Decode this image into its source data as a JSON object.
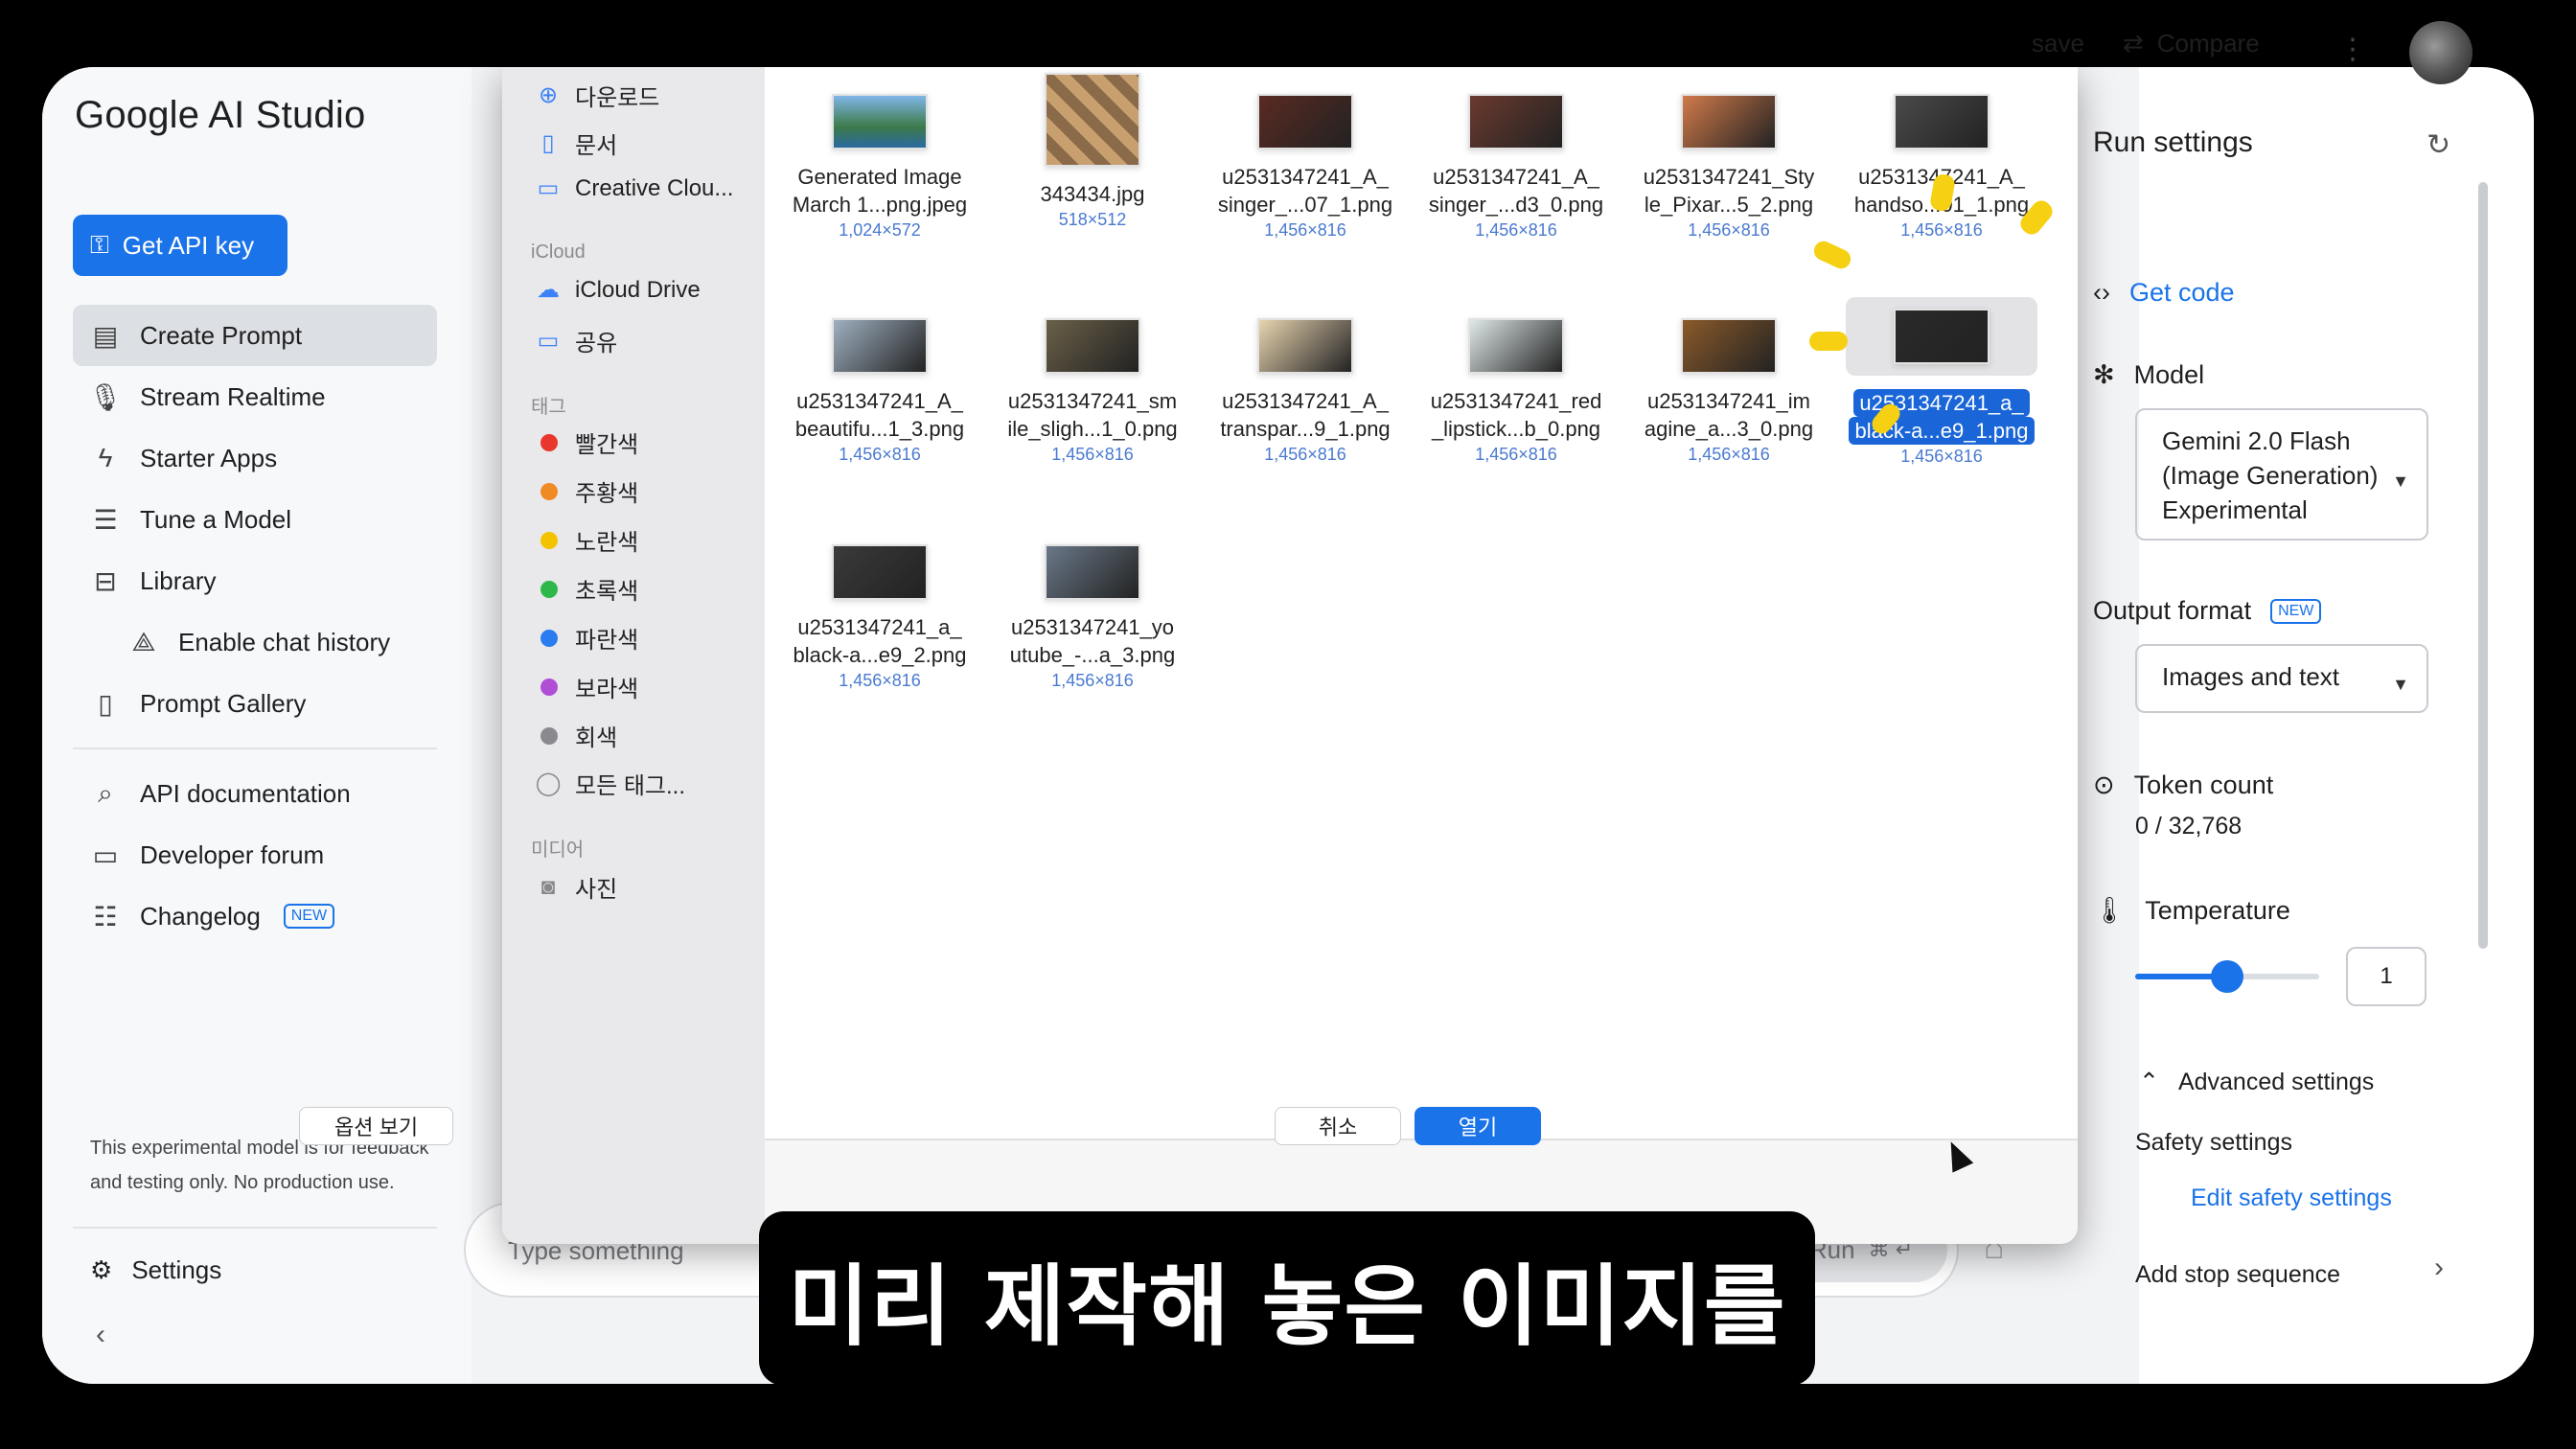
{
  "app": {
    "logo": "Google AI Studio",
    "api_key_label": "Get API key"
  },
  "nav": {
    "create_prompt": "Create Prompt",
    "stream_realtime": "Stream Realtime",
    "starter_apps": "Starter Apps",
    "tune_model": "Tune a Model",
    "library": "Library",
    "enable_chat_history": "Enable chat history",
    "prompt_gallery": "Prompt Gallery",
    "api_documentation": "API documentation",
    "developer_forum": "Developer forum",
    "changelog": "Changelog",
    "new_badge": "NEW"
  },
  "disclaimer": "This experimental model is for feedback and testing only. No production use.",
  "settings_label": "Settings",
  "prompt": {
    "placeholder": "Type something",
    "run_label": "Run",
    "run_shortcut": "⌘ ↵"
  },
  "header": {
    "save_label": "save",
    "compare_label": "Compare"
  },
  "run_settings": {
    "title": "Run settings",
    "get_code": "Get code",
    "model_label": "Model",
    "model_value": "Gemini 2.0 Flash (Image Generation) Experimental",
    "output_format_label": "Output format",
    "output_format_badge": "NEW",
    "output_format_value": "Images and text",
    "token_count_label": "Token count",
    "token_count_value": "0 / 32,768",
    "temperature_label": "Temperature",
    "temperature_value": "1",
    "temperature_fraction": 0.5,
    "advanced_label": "Advanced settings",
    "safety_label": "Safety settings",
    "edit_safety": "Edit safety settings",
    "stop_sequence": "Add stop sequence"
  },
  "dialog": {
    "favorites": [
      "다운로드",
      "문서",
      "Creative Clou..."
    ],
    "icloud_head": "iCloud",
    "icloud_items": [
      "iCloud Drive",
      "공유"
    ],
    "tags_head": "태그",
    "tags": [
      {
        "label": "빨간색",
        "color": "#e8372c"
      },
      {
        "label": "주황색",
        "color": "#f08a24"
      },
      {
        "label": "노란색",
        "color": "#f4c300"
      },
      {
        "label": "초록색",
        "color": "#2fb84a"
      },
      {
        "label": "파란색",
        "color": "#2a7cf0"
      },
      {
        "label": "보라색",
        "color": "#b04fd6"
      },
      {
        "label": "회색",
        "color": "#8a8a8e"
      }
    ],
    "all_tags": "모든 태그...",
    "media_head": "미디어",
    "photos": "사진",
    "options_label": "옵션 보기",
    "cancel_label": "취소",
    "open_label": "열기",
    "files": [
      {
        "name1": "Generated Image",
        "name2": "March 1...png.jpeg",
        "dim": "1,024×572",
        "tone": "#4a88c0"
      },
      {
        "name1": "343434.jpg",
        "name2": "",
        "dim": "518×512",
        "tone": "#b8966a"
      },
      {
        "name1": "u2531347241_A_",
        "name2": "singer_...07_1.png",
        "dim": "1,456×816",
        "tone": "#5a2a22"
      },
      {
        "name1": "u2531347241_A_",
        "name2": "singer_...d3_0.png",
        "dim": "1,456×816",
        "tone": "#6a3a2e"
      },
      {
        "name1": "u2531347241_Sty",
        "name2": "le_Pixar...5_2.png",
        "dim": "1,456×816",
        "tone": "#d07a4a"
      },
      {
        "name1": "u2531347241_A_",
        "name2": "handso...01_1.png",
        "dim": "1,456×816",
        "tone": "#4a4a4a"
      },
      {
        "name1": "u2531347241_A_",
        "name2": "beautifu...1_3.png",
        "dim": "1,456×816",
        "tone": "#9fb0c0"
      },
      {
        "name1": "u2531347241_sm",
        "name2": "ile_sligh...1_0.png",
        "dim": "1,456×816",
        "tone": "#6a6048"
      },
      {
        "name1": "u2531347241_A_",
        "name2": "transpar...9_1.png",
        "dim": "1,456×816",
        "tone": "#e8d4b0"
      },
      {
        "name1": "u2531347241_red",
        "name2": "_lipstick...b_0.png",
        "dim": "1,456×816",
        "tone": "#dfe8e8"
      },
      {
        "name1": "u2531347241_im",
        "name2": "agine_a...3_0.png",
        "dim": "1,456×816",
        "tone": "#8a5a2a"
      },
      {
        "name1": "u2531347241_a_",
        "name2": "black-a...e9_1.png",
        "dim": "1,456×816",
        "tone": "#2a2a2a"
      },
      {
        "name1": "u2531347241_a_",
        "name2": "black-a...e9_2.png",
        "dim": "1,456×816",
        "tone": "#3a3a3a"
      },
      {
        "name1": "u2531347241_yo",
        "name2": "utube_-...a_3.png",
        "dim": "1,456×816",
        "tone": "#6a7888"
      }
    ]
  },
  "subtitle": "미리 제작해 놓은 이미지를"
}
